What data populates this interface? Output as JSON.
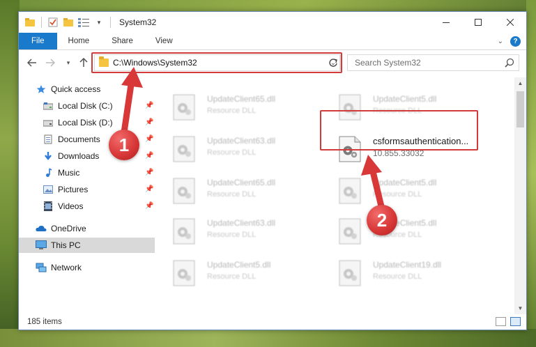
{
  "window": {
    "title": "System32"
  },
  "ribbon": {
    "tabs": [
      "File",
      "Home",
      "Share",
      "View"
    ],
    "help_icon": "question-icon"
  },
  "address_bar": {
    "path": "C:\\Windows\\System32",
    "search_placeholder": "Search System32"
  },
  "nav_pane": {
    "items": [
      {
        "label": "Quick access",
        "icon": "star-icon"
      },
      {
        "label": "Local Disk (C:)",
        "icon": "drive-icon"
      },
      {
        "label": "Local Disk (D:)",
        "icon": "drive-icon"
      },
      {
        "label": "Documents",
        "icon": "documents-icon"
      },
      {
        "label": "Downloads",
        "icon": "download-arrow-icon"
      },
      {
        "label": "Music",
        "icon": "music-note-icon"
      },
      {
        "label": "Pictures",
        "icon": "pictures-icon"
      },
      {
        "label": "Videos",
        "icon": "video-film-icon"
      },
      {
        "label": "OneDrive",
        "icon": "cloud-icon"
      },
      {
        "label": "This PC",
        "icon": "monitor-icon"
      },
      {
        "label": "Network",
        "icon": "network-icon"
      }
    ]
  },
  "files": [
    {
      "name": "UpdateClient65.dll",
      "sub": "Resource DLL"
    },
    {
      "name": "UpdateClient5.dll",
      "sub": "Resource DLL"
    },
    {
      "name": "UpdateClient63.dll",
      "sub": "Resource DLL"
    },
    {
      "name": "csformsauthentication...",
      "sub": "10.855.33032"
    },
    {
      "name": "UpdateClient65.dll",
      "sub": "Resource DLL"
    },
    {
      "name": "UpdateClient5.dll",
      "sub": "Resource DLL"
    },
    {
      "name": "UpdateClient63.dll",
      "sub": "Resource DLL"
    },
    {
      "name": "UpdateClient5.dll",
      "sub": "Resource DLL"
    },
    {
      "name": "UpdateClient5.dll",
      "sub": "Resource DLL"
    },
    {
      "name": "UpdateClient19.dll",
      "sub": "Resource DLL"
    }
  ],
  "status": {
    "item_count": "185 items"
  },
  "annotations": {
    "step1": "1",
    "step2": "2",
    "color": "#d33a3a"
  }
}
